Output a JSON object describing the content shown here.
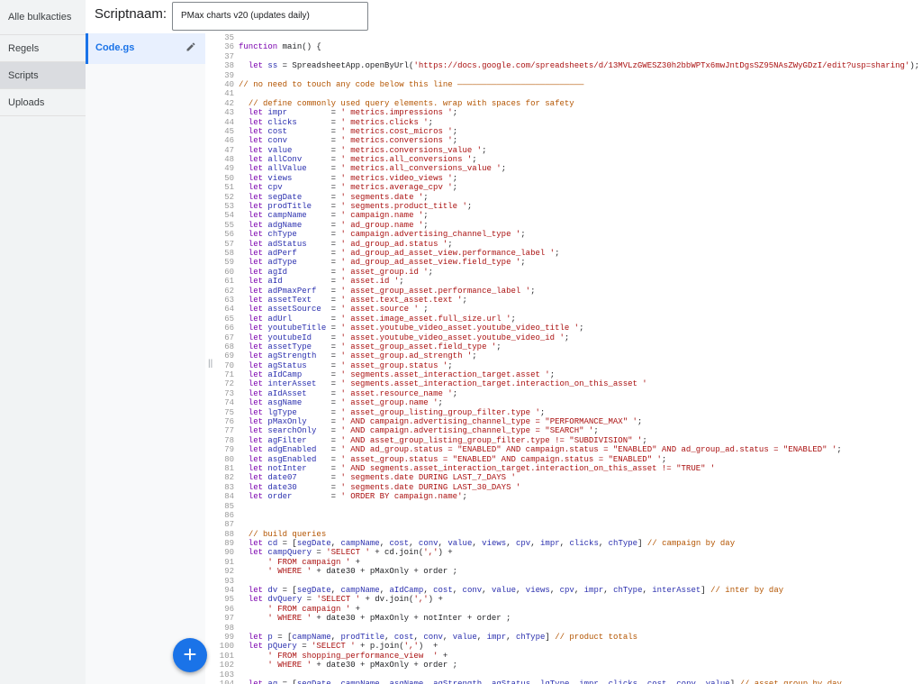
{
  "nav": {
    "items": [
      "Alle bulkacties",
      "Regels",
      "Scripts",
      "Uploads"
    ],
    "active_index": 2
  },
  "header": {
    "label": "Scriptnaam:",
    "script_name": "PMax charts v20 (updates daily)"
  },
  "files": [
    {
      "name": "Code.gs",
      "edit_icon": "pencil-icon"
    }
  ],
  "fab": {
    "label": "+",
    "icon": "plus-icon"
  },
  "colors": {
    "accent": "#1a73e8",
    "keyword": "#7a00ae",
    "comment": "#b35400",
    "string": "#a11",
    "variable": "#2a2fae"
  },
  "code_lines": [
    {
      "n": "35",
      "t": ""
    },
    {
      "n": "36",
      "t": "function main() {"
    },
    {
      "n": "37",
      "t": ""
    },
    {
      "n": "38",
      "t": "  let ss = SpreadsheetApp.openByUrl('https://docs.google.com/spreadsheets/d/13MVLzGWESZ30h2bbWPTx6mwJntDgsSZ95NAsZWyGDzI/edit?usp=sharing');"
    },
    {
      "n": "39",
      "t": ""
    },
    {
      "n": "40",
      "t": "// no need to touch any code below this line ——————————————————————————"
    },
    {
      "n": "41",
      "t": ""
    },
    {
      "n": "42",
      "t": "  // define commonly used query elements. wrap with spaces for safety"
    },
    {
      "n": "43",
      "t": "  let impr         = ' metrics.impressions ';"
    },
    {
      "n": "44",
      "t": "  let clicks       = ' metrics.clicks ';"
    },
    {
      "n": "45",
      "t": "  let cost         = ' metrics.cost_micros ';"
    },
    {
      "n": "46",
      "t": "  let conv         = ' metrics.conversions ';"
    },
    {
      "n": "47",
      "t": "  let value        = ' metrics.conversions_value ';"
    },
    {
      "n": "48",
      "t": "  let allConv      = ' metrics.all_conversions ';"
    },
    {
      "n": "49",
      "t": "  let allValue     = ' metrics.all_conversions_value ';"
    },
    {
      "n": "50",
      "t": "  let views        = ' metrics.video_views ';"
    },
    {
      "n": "51",
      "t": "  let cpv          = ' metrics.average_cpv ';"
    },
    {
      "n": "52",
      "t": "  let segDate      = ' segments.date ';"
    },
    {
      "n": "53",
      "t": "  let prodTitle    = ' segments.product_title ';"
    },
    {
      "n": "54",
      "t": "  let campName     = ' campaign.name ';"
    },
    {
      "n": "55",
      "t": "  let adgName      = ' ad_group.name ';"
    },
    {
      "n": "56",
      "t": "  let chType       = ' campaign.advertising_channel_type ';"
    },
    {
      "n": "57",
      "t": "  let adStatus     = ' ad_group_ad.status ';"
    },
    {
      "n": "58",
      "t": "  let adPerf       = ' ad_group_ad_asset_view.performance_label ';"
    },
    {
      "n": "59",
      "t": "  let adType       = ' ad_group_ad_asset_view.field_type ';"
    },
    {
      "n": "60",
      "t": "  let agId         = ' asset_group.id ';"
    },
    {
      "n": "61",
      "t": "  let aId          = ' asset.id ';"
    },
    {
      "n": "62",
      "t": "  let adPmaxPerf   = ' asset_group_asset.performance_label ';"
    },
    {
      "n": "63",
      "t": "  let assetText    = ' asset.text_asset.text ';"
    },
    {
      "n": "64",
      "t": "  let assetSource  = ' asset.source ' ;"
    },
    {
      "n": "65",
      "t": "  let adUrl        = ' asset.image_asset.full_size.url ';"
    },
    {
      "n": "66",
      "t": "  let youtubeTitle = ' asset.youtube_video_asset.youtube_video_title ';"
    },
    {
      "n": "67",
      "t": "  let youtubeId    = ' asset.youtube_video_asset.youtube_video_id ';"
    },
    {
      "n": "68",
      "t": "  let assetType    = ' asset_group_asset.field_type ';"
    },
    {
      "n": "69",
      "t": "  let agStrength   = ' asset_group.ad_strength ';"
    },
    {
      "n": "70",
      "t": "  let agStatus     = ' asset_group.status ';"
    },
    {
      "n": "71",
      "t": "  let aIdCamp      = ' segments.asset_interaction_target.asset ';"
    },
    {
      "n": "72",
      "t": "  let interAsset   = ' segments.asset_interaction_target.interaction_on_this_asset '"
    },
    {
      "n": "73",
      "t": "  let aIdAsset     = ' asset.resource_name ';"
    },
    {
      "n": "74",
      "t": "  let asgName      = ' asset_group.name ';"
    },
    {
      "n": "75",
      "t": "  let lgType       = ' asset_group_listing_group_filter.type ';"
    },
    {
      "n": "76",
      "t": "  let pMaxOnly     = ' AND campaign.advertising_channel_type = \"PERFORMANCE_MAX\" ';"
    },
    {
      "n": "77",
      "t": "  let searchOnly   = ' AND campaign.advertising_channel_type = \"SEARCH\" ';"
    },
    {
      "n": "78",
      "t": "  let agFilter     = ' AND asset_group_listing_group_filter.type != \"SUBDIVISION\" ';"
    },
    {
      "n": "79",
      "t": "  let adgEnabled   = ' AND ad_group.status = \"ENABLED\" AND campaign.status = \"ENABLED\" AND ad_group_ad.status = \"ENABLED\" ';"
    },
    {
      "n": "80",
      "t": "  let asgEnabled   = ' asset_group.status = \"ENABLED\" AND campaign.status = \"ENABLED\" ';"
    },
    {
      "n": "81",
      "t": "  let notInter     = ' AND segments.asset_interaction_target.interaction_on_this_asset != \"TRUE\" '"
    },
    {
      "n": "82",
      "t": "  let date07       = ' segments.date DURING LAST_7_DAYS '"
    },
    {
      "n": "83",
      "t": "  let date30       = ' segments.date DURING LAST_30_DAYS '"
    },
    {
      "n": "84",
      "t": "  let order        = ' ORDER BY campaign.name';"
    },
    {
      "n": "85",
      "t": ""
    },
    {
      "n": "86",
      "t": ""
    },
    {
      "n": "87",
      "t": ""
    },
    {
      "n": "88",
      "t": "  // build queries"
    },
    {
      "n": "89",
      "t": "  let cd = [segDate, campName, cost, conv, value, views, cpv, impr, clicks, chType] // campaign by day"
    },
    {
      "n": "90",
      "t": "  let campQuery = 'SELECT ' + cd.join(',') +"
    },
    {
      "n": "91",
      "t": "      ' FROM campaign ' +"
    },
    {
      "n": "92",
      "t": "      ' WHERE ' + date30 + pMaxOnly + order ;"
    },
    {
      "n": "93",
      "t": ""
    },
    {
      "n": "94",
      "t": "  let dv = [segDate, campName, aIdCamp, cost, conv, value, views, cpv, impr, chType, interAsset] // inter by day"
    },
    {
      "n": "95",
      "t": "  let dvQuery = 'SELECT ' + dv.join(',') +"
    },
    {
      "n": "96",
      "t": "      ' FROM campaign ' +"
    },
    {
      "n": "97",
      "t": "      ' WHERE ' + date30 + pMaxOnly + notInter + order ;"
    },
    {
      "n": "98",
      "t": ""
    },
    {
      "n": "99",
      "t": "  let p = [campName, prodTitle, cost, conv, value, impr, chType] // product totals"
    },
    {
      "n": "100",
      "t": "  let pQuery = 'SELECT ' + p.join(',')  +"
    },
    {
      "n": "101",
      "t": "      ' FROM shopping_performance_view  ' +"
    },
    {
      "n": "102",
      "t": "      ' WHERE ' + date30 + pMaxOnly + order ;"
    },
    {
      "n": "103",
      "t": ""
    },
    {
      "n": "104",
      "t": "  let ag = [segDate, campName, asgName, agStrength, agStatus, lgType, impr, clicks, cost, conv, value] // asset group by day"
    }
  ]
}
